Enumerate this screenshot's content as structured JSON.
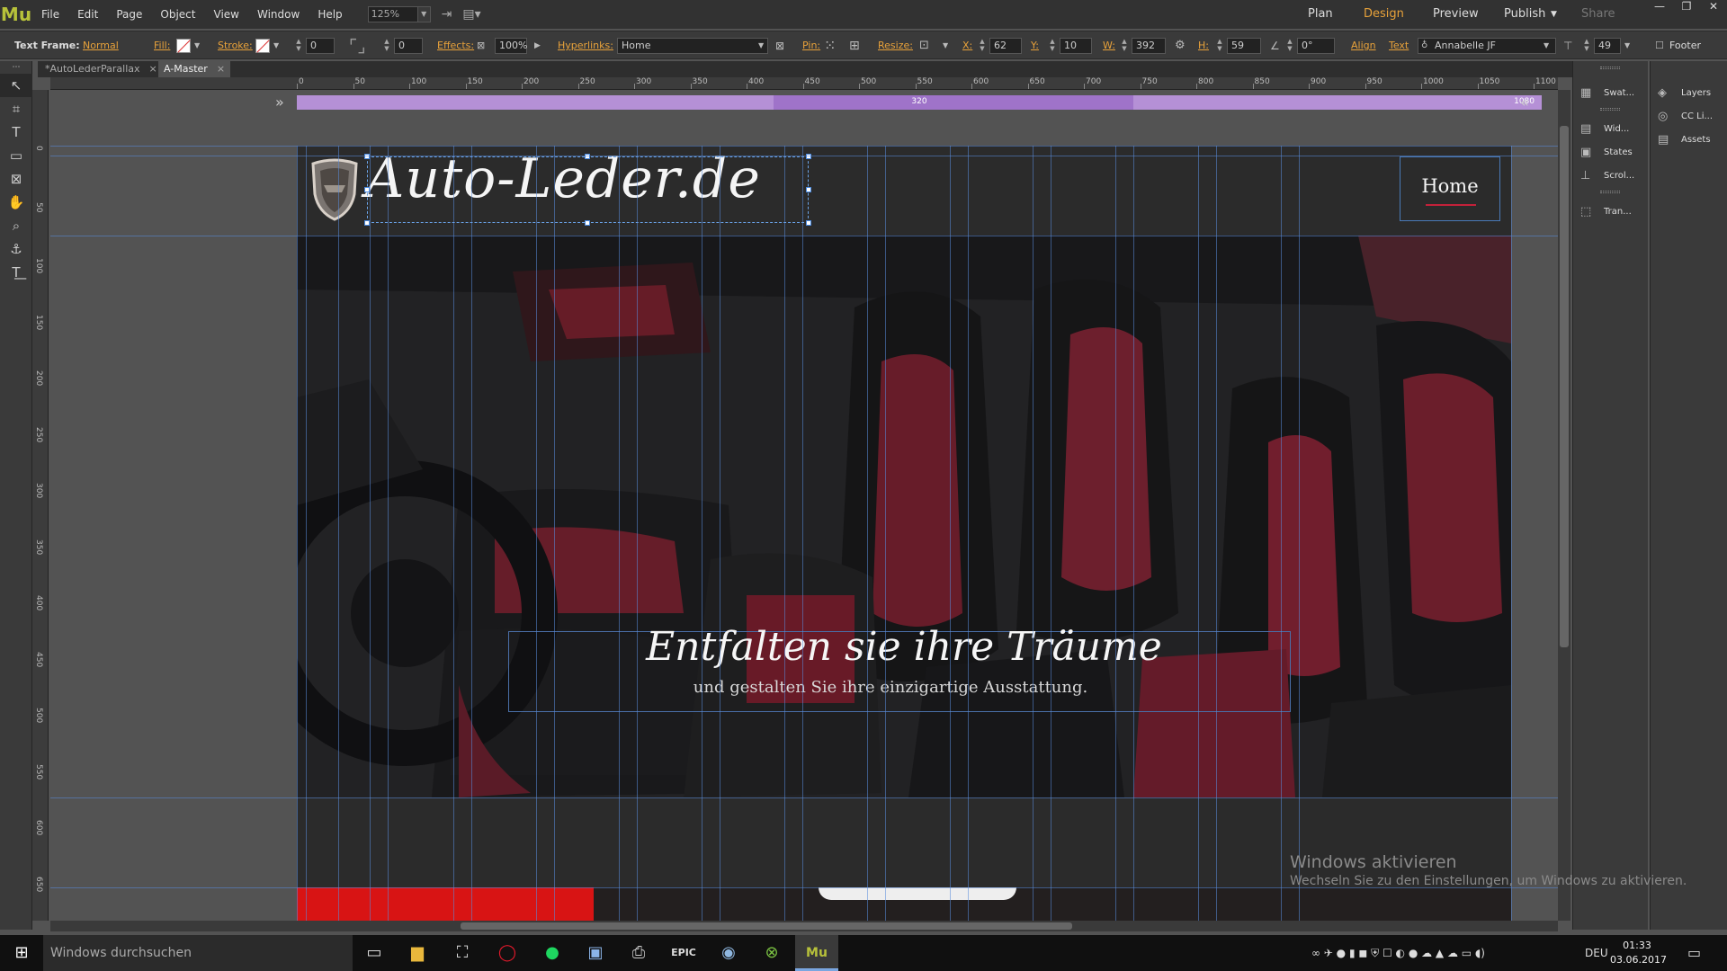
{
  "app": {
    "logo": "Mu",
    "menu": [
      "File",
      "Edit",
      "Page",
      "Object",
      "View",
      "Window",
      "Help"
    ],
    "zoom": "125%",
    "modes": {
      "plan": "Plan",
      "design": "Design",
      "preview": "Preview",
      "publish": "Publish",
      "share": "Share"
    },
    "active_mode": "Design"
  },
  "control_bar": {
    "text_frame_label": "Text Frame:",
    "text_frame_value": "Normal",
    "fill_label": "Fill:",
    "stroke_label": "Stroke:",
    "stroke_value": "0",
    "corner_value": "0",
    "effects_label": "Effects:",
    "opacity_value": "100%",
    "hyperlinks_label": "Hyperlinks:",
    "hyperlink_value": "Home",
    "pin_label": "Pin:",
    "resize_label": "Resize:",
    "x_label": "X:",
    "x_value": "62",
    "y_label": "Y:",
    "y_value": "10",
    "w_label": "W:",
    "w_value": "392",
    "h_label": "H:",
    "h_value": "59",
    "rotation_value": "0°",
    "align_label": "Align",
    "text_label": "Text",
    "font_value": "Annabelle JF",
    "font_size_value": "49",
    "footer_label": "Footer"
  },
  "tabs": [
    {
      "label": "*AutoLederParallax",
      "close": "×"
    },
    {
      "label": "A-Master",
      "close": "×"
    }
  ],
  "rulers": {
    "horizontal": [
      "0",
      "50",
      "100",
      "150",
      "200",
      "250",
      "300",
      "350",
      "400",
      "450",
      "500",
      "550",
      "600",
      "650",
      "700",
      "750",
      "800",
      "850",
      "900",
      "950",
      "1000",
      "1050",
      "1100"
    ],
    "vertical": [
      "0",
      "50",
      "100",
      "150",
      "200",
      "250",
      "300",
      "350",
      "400",
      "450",
      "500",
      "550",
      "600",
      "650"
    ]
  },
  "breakpoints": {
    "center": "320",
    "right": "1080"
  },
  "page": {
    "site_title": "Auto-Leder.de",
    "nav_home": "Home",
    "headline": "Entfalten sie ihre Träume",
    "subline": "und gestalten Sie ihre einzigartige Ausstattung."
  },
  "panels": {
    "left": [
      "Swat...",
      "Wid...",
      "States",
      "Scrol...",
      "Tran..."
    ],
    "right": [
      "Layers",
      "CC Li...",
      "Assets"
    ]
  },
  "watermark": {
    "line1": "Windows aktivieren",
    "line2": "Wechseln Sie zu den Einstellungen, um Windows zu aktivieren."
  },
  "taskbar": {
    "search": "Windows durchsuchen",
    "language": "DEU",
    "time": "01:33",
    "date": "03.06.2017"
  }
}
